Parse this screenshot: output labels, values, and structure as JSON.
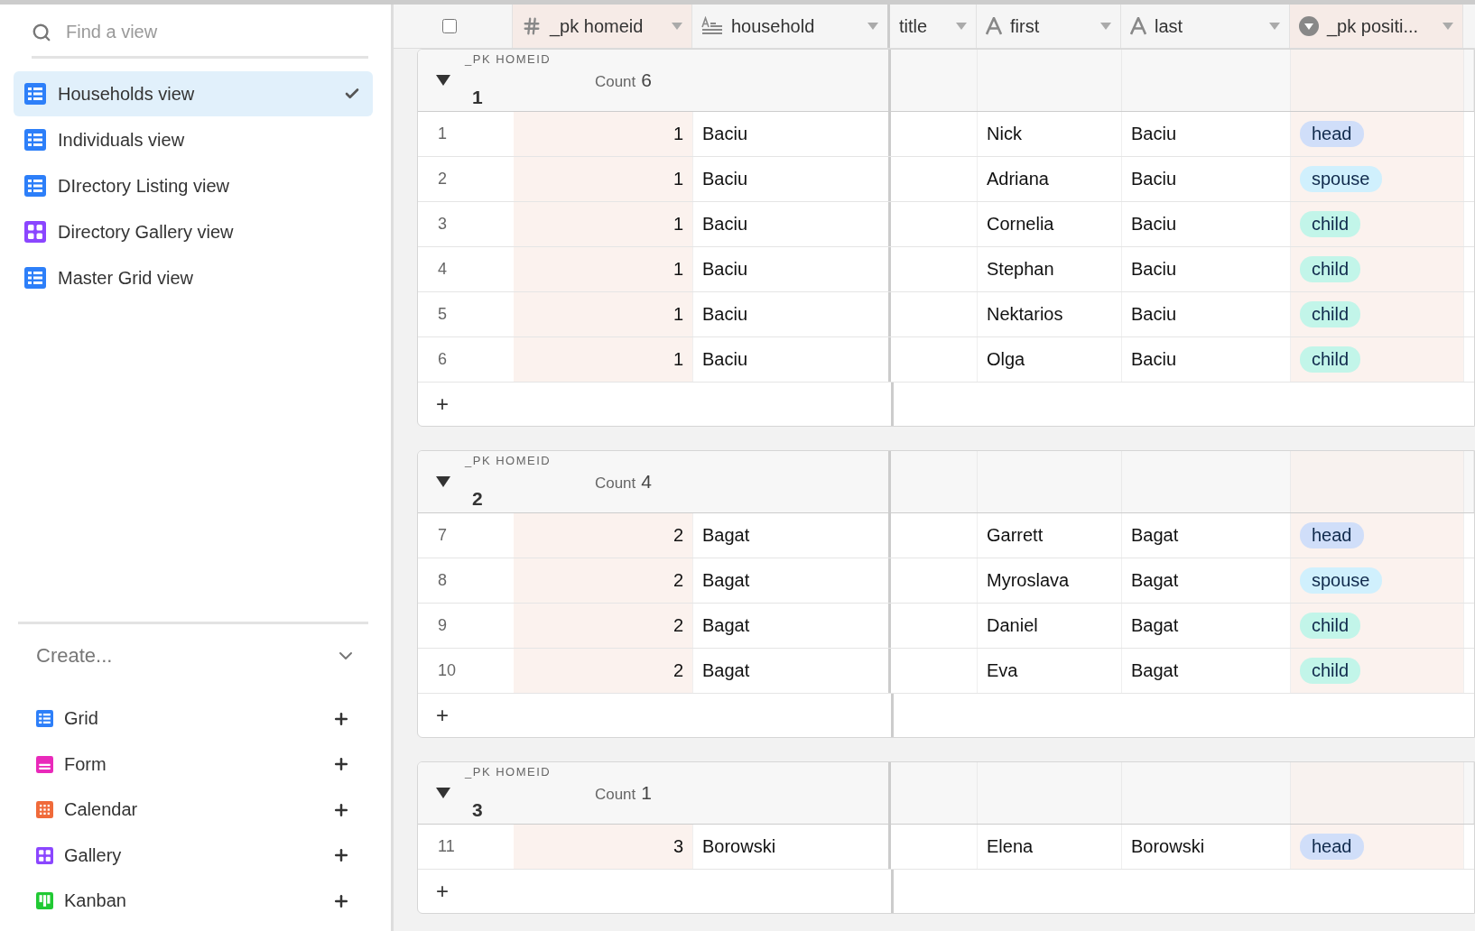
{
  "sidebar": {
    "search": {
      "placeholder": "Find a view"
    },
    "views": [
      {
        "label": "Households view",
        "kind": "grid",
        "selected": true
      },
      {
        "label": "Individuals view",
        "kind": "grid",
        "selected": false
      },
      {
        "label": "DIrectory Listing view",
        "kind": "grid",
        "selected": false
      },
      {
        "label": "Directory Gallery view",
        "kind": "gallery",
        "selected": false
      },
      {
        "label": "Master Grid view",
        "kind": "grid",
        "selected": false
      }
    ],
    "create": {
      "label": "Create...",
      "expanded": true,
      "items": [
        {
          "label": "Grid",
          "kind": "grid"
        },
        {
          "label": "Form",
          "kind": "form"
        },
        {
          "label": "Calendar",
          "kind": "calendar"
        },
        {
          "label": "Gallery",
          "kind": "gallery"
        },
        {
          "label": "Kanban",
          "kind": "kanban"
        }
      ]
    }
  },
  "table": {
    "select_all": {
      "checked": false
    },
    "columns": [
      {
        "label": "_pk homeid",
        "kind": "number",
        "highlighted": true
      },
      {
        "label": "household",
        "kind": "longtext",
        "highlighted": false
      },
      {
        "label": "title",
        "kind": "hidden",
        "highlighted": false
      },
      {
        "label": "first",
        "kind": "text",
        "highlighted": false
      },
      {
        "label": "last",
        "kind": "text",
        "highlighted": false
      },
      {
        "label": "_pk positi...",
        "kind": "select",
        "highlighted": true
      }
    ],
    "groups": [
      {
        "field": "_PK HOMEID",
        "value": "1",
        "count_label": "Count",
        "count": "6",
        "expanded": true,
        "add": "+",
        "rows": [
          {
            "number": "1",
            "cells": [
              "1",
              "Baciu",
              "",
              "Nick",
              "Baciu"
            ],
            "tag": {
              "label": "head",
              "color": "#d0def9"
            }
          },
          {
            "number": "2",
            "cells": [
              "1",
              "Baciu",
              "",
              "Adriana",
              "Baciu"
            ],
            "tag": {
              "label": "spouse",
              "color": "#d0f0fd"
            }
          },
          {
            "number": "3",
            "cells": [
              "1",
              "Baciu",
              "",
              "Cornelia",
              "Baciu"
            ],
            "tag": {
              "label": "child",
              "color": "#c2f5e9"
            }
          },
          {
            "number": "4",
            "cells": [
              "1",
              "Baciu",
              "",
              "Stephan",
              "Baciu"
            ],
            "tag": {
              "label": "child",
              "color": "#c2f5e9"
            }
          },
          {
            "number": "5",
            "cells": [
              "1",
              "Baciu",
              "",
              "Nektarios",
              "Baciu"
            ],
            "tag": {
              "label": "child",
              "color": "#c2f5e9"
            }
          },
          {
            "number": "6",
            "cells": [
              "1",
              "Baciu",
              "",
              "Olga",
              "Baciu"
            ],
            "tag": {
              "label": "child",
              "color": "#c2f5e9"
            }
          }
        ]
      },
      {
        "field": "_PK HOMEID",
        "value": "2",
        "count_label": "Count",
        "count": "4",
        "expanded": true,
        "add": "+",
        "rows": [
          {
            "number": "7",
            "cells": [
              "2",
              "Bagat",
              "",
              "Garrett",
              "Bagat"
            ],
            "tag": {
              "label": "head",
              "color": "#d0def9"
            }
          },
          {
            "number": "8",
            "cells": [
              "2",
              "Bagat",
              "",
              "Myroslava",
              "Bagat"
            ],
            "tag": {
              "label": "spouse",
              "color": "#d0f0fd"
            }
          },
          {
            "number": "9",
            "cells": [
              "2",
              "Bagat",
              "",
              "Daniel",
              "Bagat"
            ],
            "tag": {
              "label": "child",
              "color": "#c2f5e9"
            }
          },
          {
            "number": "10",
            "cells": [
              "2",
              "Bagat",
              "",
              "Eva",
              "Bagat"
            ],
            "tag": {
              "label": "child",
              "color": "#c2f5e9"
            }
          }
        ]
      },
      {
        "field": "_PK HOMEID",
        "value": "3",
        "count_label": "Count",
        "count": "1",
        "expanded": true,
        "add": "+",
        "rows": [
          {
            "number": "11",
            "cells": [
              "3",
              "Borowski",
              "",
              "Elena",
              "Borowski"
            ],
            "tag": {
              "label": "head",
              "color": "#d0def9"
            }
          }
        ]
      }
    ]
  }
}
